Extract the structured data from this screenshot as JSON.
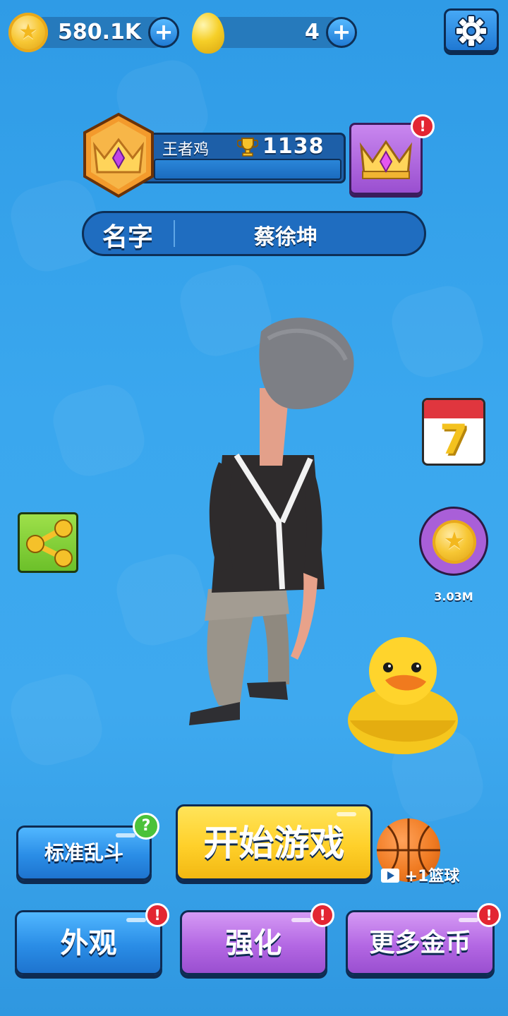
{
  "currency": {
    "coins": "580.1K",
    "eggs": "4",
    "plus_label": "+"
  },
  "player": {
    "rank_title": "王者鸡",
    "trophy_score": "1138",
    "name_label": "名字",
    "name_value": "蔡徐坤"
  },
  "side": {
    "calendar_day": "7",
    "coin_reward": "3.03M"
  },
  "alerts": {
    "mark": "!",
    "help_mark": "?"
  },
  "buttons": {
    "mode": "标准乱斗",
    "start": "开始游戏",
    "ball_reward": "+1篮球",
    "appearance": "外观",
    "upgrade": "强化",
    "more_coins": "更多金币"
  },
  "colors": {
    "background": "#3aa7ee",
    "blue_button": "#2a8de6",
    "purple_button": "#b367e3",
    "yellow_button": "#ffd02a",
    "alert_red": "#e32632"
  },
  "icons": [
    "gold-coin-icon",
    "golden-egg-icon",
    "plus-icon",
    "gear-icon",
    "rank-badge-icon",
    "trophy-icon",
    "crown-icon",
    "calendar-icon",
    "coin-icon",
    "share-icon",
    "help-icon",
    "basketball-icon",
    "video-icon"
  ]
}
